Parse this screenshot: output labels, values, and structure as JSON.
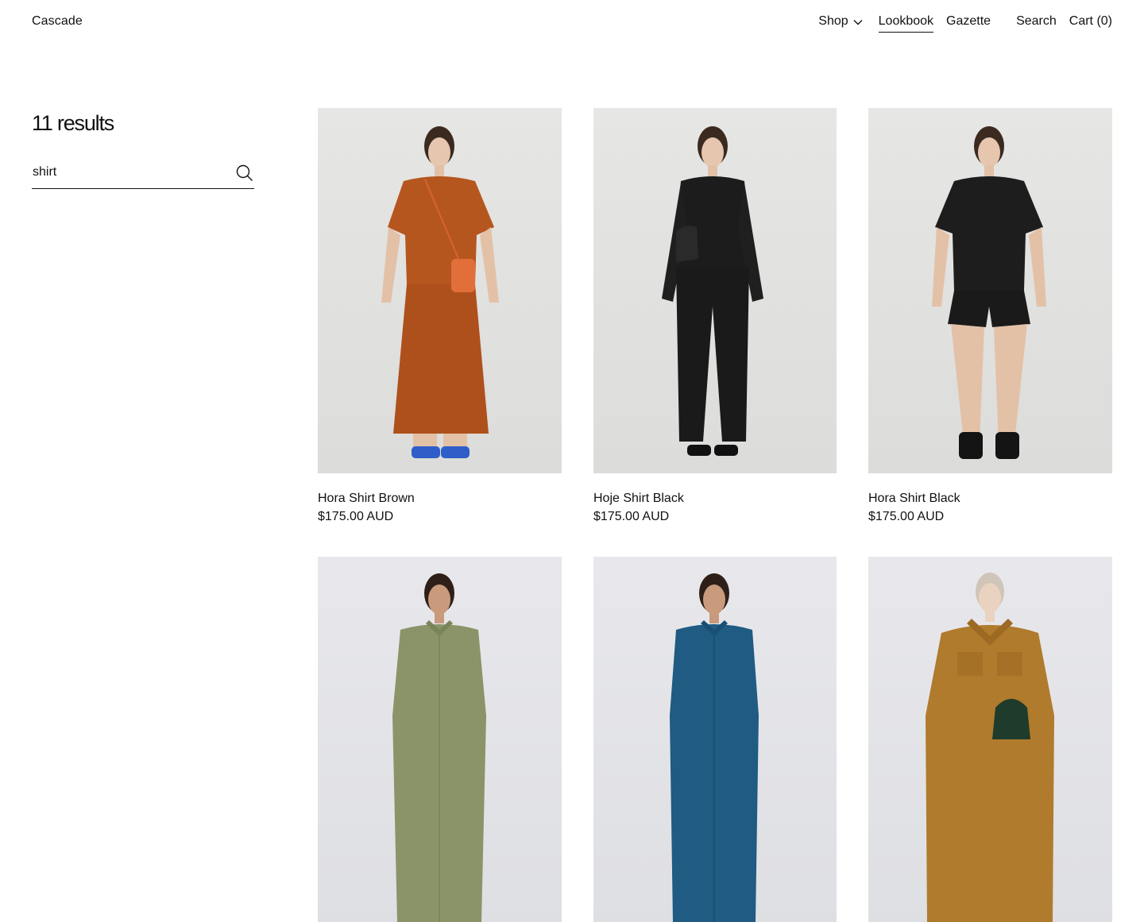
{
  "header": {
    "brand": "Cascade",
    "nav": {
      "shop": "Shop",
      "lookbook": "Lookbook",
      "gazette": "Gazette",
      "search": "Search",
      "cart": "Cart (0)"
    }
  },
  "sidebar": {
    "results_count": "11 results",
    "search_value": "shirt"
  },
  "products": [
    {
      "name": "Hora Shirt Brown",
      "price": "$175.00 AUD"
    },
    {
      "name": "Hoje Shirt Black",
      "price": "$175.00 AUD"
    },
    {
      "name": "Hora Shirt Black",
      "price": "$175.00 AUD"
    },
    {
      "name": "",
      "price": ""
    },
    {
      "name": "",
      "price": ""
    },
    {
      "name": "",
      "price": ""
    }
  ],
  "colors": {
    "text": "#111111",
    "image_bg": "#e3e3e1",
    "rust": "#b5561f",
    "black_garment": "#1c1c1c",
    "olive": "#8a9468",
    "teal_blue": "#1f5b82",
    "mustard": "#b07b2c"
  }
}
